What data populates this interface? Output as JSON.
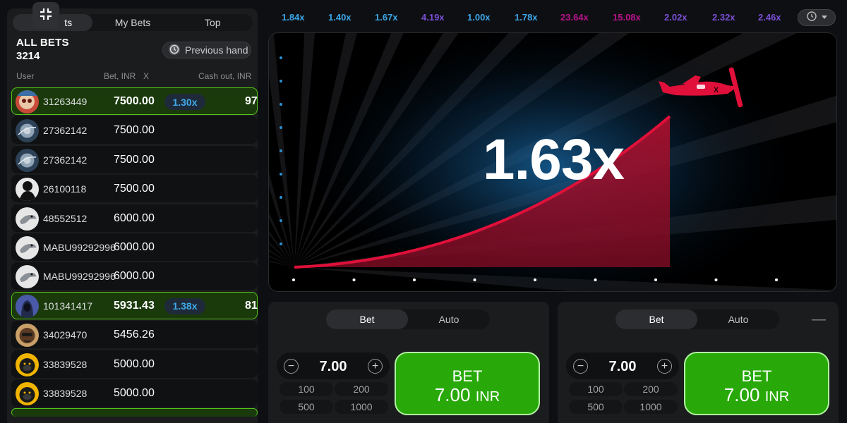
{
  "left_panel": {
    "tabs": [
      {
        "label": "All Bets",
        "active": true
      },
      {
        "label": "My Bets",
        "active": false
      },
      {
        "label": "Top",
        "active": false
      }
    ],
    "tab_visible_fragment": "ts",
    "all_bets_title": "ALL BETS",
    "all_bets_count": "3214",
    "previous_hand_label": "Previous hand",
    "columns": {
      "user": "User",
      "bet": "Bet, INR",
      "x": "X",
      "cashout": "Cash out, INR"
    },
    "rows": [
      {
        "user": "31263449",
        "bet": "7500.00",
        "mult": "1.30x",
        "cashout": "97",
        "win": true,
        "avatar": "skull"
      },
      {
        "user": "27362142",
        "bet": "7500.00",
        "mult": "",
        "cashout": "",
        "win": false,
        "avatar": "planet"
      },
      {
        "user": "27362142",
        "bet": "7500.00",
        "mult": "",
        "cashout": "",
        "win": false,
        "avatar": "planet"
      },
      {
        "user": "26100118",
        "bet": "7500.00",
        "mult": "",
        "cashout": "",
        "win": false,
        "avatar": "silhouette"
      },
      {
        "user": "48552512",
        "bet": "6000.00",
        "mult": "",
        "cashout": "",
        "win": false,
        "avatar": "eagle"
      },
      {
        "user": "MABU99292996",
        "bet": "6000.00",
        "mult": "",
        "cashout": "",
        "win": false,
        "avatar": "eagle"
      },
      {
        "user": "MABU99292996",
        "bet": "6000.00",
        "mult": "",
        "cashout": "",
        "win": false,
        "avatar": "eagle"
      },
      {
        "user": "101341417",
        "bet": "5931.43",
        "mult": "1.38x",
        "cashout": "81",
        "win": true,
        "avatar": "hooded"
      },
      {
        "user": "34029470",
        "bet": "5456.26",
        "mult": "",
        "cashout": "",
        "win": false,
        "avatar": "face"
      },
      {
        "user": "33839528",
        "bet": "5000.00",
        "mult": "",
        "cashout": "",
        "win": false,
        "avatar": "gorilla"
      },
      {
        "user": "33839528",
        "bet": "5000.00",
        "mult": "",
        "cashout": "",
        "win": false,
        "avatar": "gorilla"
      }
    ]
  },
  "history": {
    "items": [
      {
        "value": "1.84x",
        "color": "#3ba6e8"
      },
      {
        "value": "1.40x",
        "color": "#3ba6e8"
      },
      {
        "value": "1.67x",
        "color": "#3ba6e8"
      },
      {
        "value": "4.19x",
        "color": "#7a4fd6"
      },
      {
        "value": "1.00x",
        "color": "#3ba6e8"
      },
      {
        "value": "1.78x",
        "color": "#3ba6e8"
      },
      {
        "value": "23.64x",
        "color": "#b8138a"
      },
      {
        "value": "15.08x",
        "color": "#b8138a"
      },
      {
        "value": "2.02x",
        "color": "#7a4fd6"
      },
      {
        "value": "2.32x",
        "color": "#7a4fd6"
      },
      {
        "value": "2.46x",
        "color": "#7a4fd6"
      }
    ],
    "history_icon": "history-icon"
  },
  "game": {
    "multiplier": "1.63x",
    "curve_color": "#e0103a",
    "plane_color": "#e0103a"
  },
  "bet_panels": [
    {
      "tab_bet": "Bet",
      "tab_auto": "Auto",
      "amount": "7.00",
      "quick": [
        "100",
        "200",
        "500",
        "1000"
      ],
      "button_title": "BET",
      "button_amount": "7.00",
      "button_currency": "INR",
      "has_minus": false
    },
    {
      "tab_bet": "Bet",
      "tab_auto": "Auto",
      "amount": "7.00",
      "quick": [
        "100",
        "200",
        "500",
        "1000"
      ],
      "button_title": "BET",
      "button_amount": "7.00",
      "button_currency": "INR",
      "has_minus": true
    }
  ],
  "colors": {
    "accent_green": "#28a909",
    "win_border": "#56c51b",
    "mult_blue": "#40a9e8"
  }
}
